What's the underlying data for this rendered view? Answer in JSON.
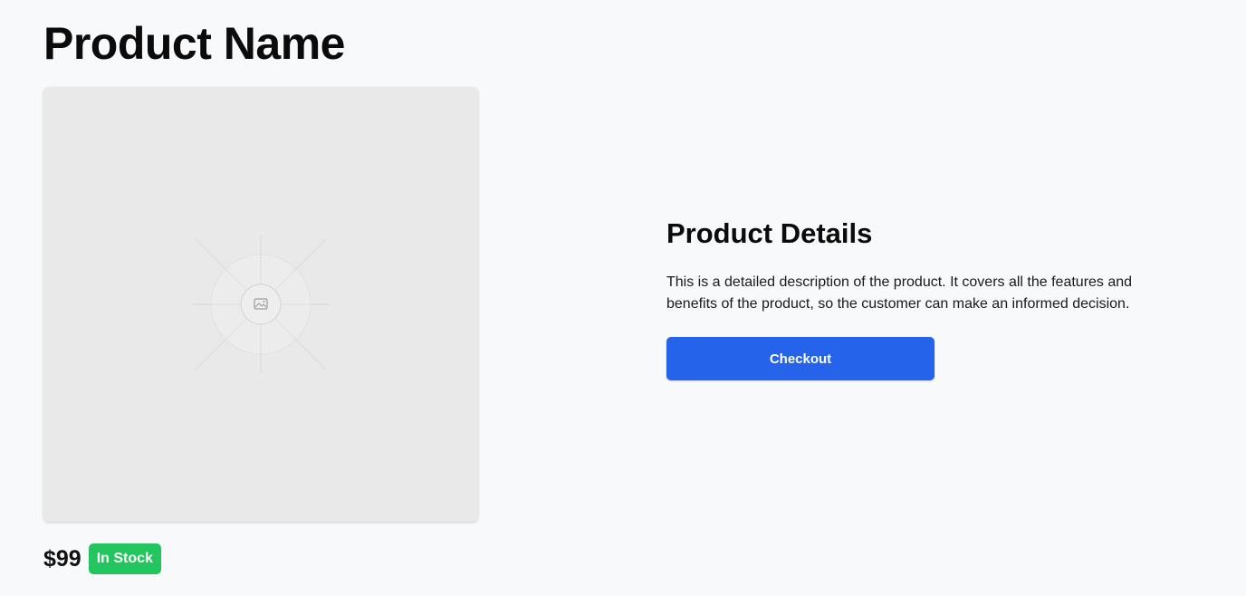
{
  "product": {
    "title": "Product Name",
    "image_icon": "image-placeholder-icon",
    "price": "$99",
    "stock_status": "In Stock"
  },
  "details": {
    "heading": "Product Details",
    "description": "This is a detailed description of the product. It covers all the features and benefits of the product, so the customer can make an informed decision.",
    "checkout_label": "Checkout"
  },
  "colors": {
    "page_background": "#f8f9fb",
    "image_background": "#e9e9e9",
    "accent": "#2563eb",
    "in_stock": "#22c55e"
  }
}
